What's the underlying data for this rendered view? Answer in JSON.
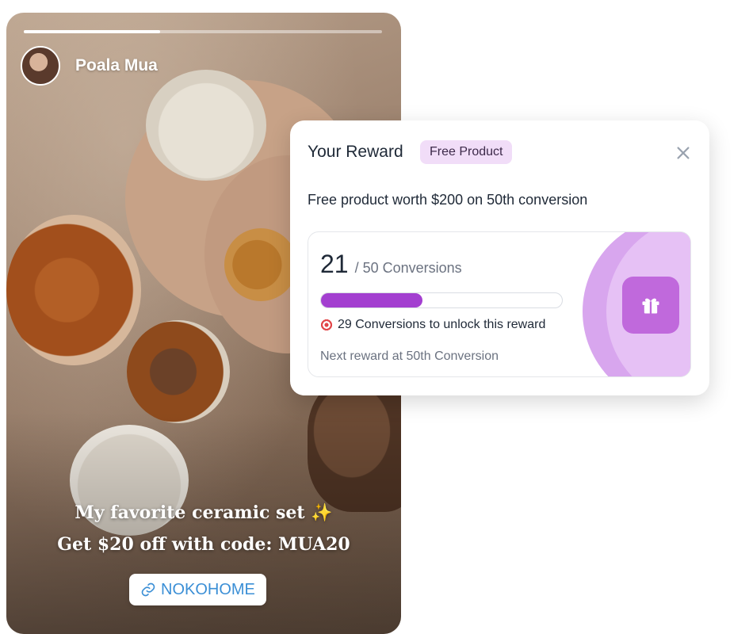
{
  "story": {
    "username": "Poala Mua",
    "progress": 0.38,
    "caption_line1": "My favorite ceramic set",
    "caption_sparkle": "✨",
    "caption_line2": "Get $20 off with code: MUA20",
    "link_label": "NOKOHOME",
    "link_icon": "link-icon"
  },
  "reward": {
    "title": "Your Reward",
    "tag": "Free Product",
    "close_icon": "close-icon",
    "description": "Free product worth $200 on 50th conversion",
    "current": "21",
    "total_label": "/ 50 Conversions",
    "progress": 0.42,
    "unlock_text": "29 Conversions to unlock this reward",
    "next_reward": "Next reward at 50th Conversion",
    "gift_icon": "gift-icon",
    "accent_color": "#a33fd0",
    "tag_color": "#f1ddf8"
  }
}
